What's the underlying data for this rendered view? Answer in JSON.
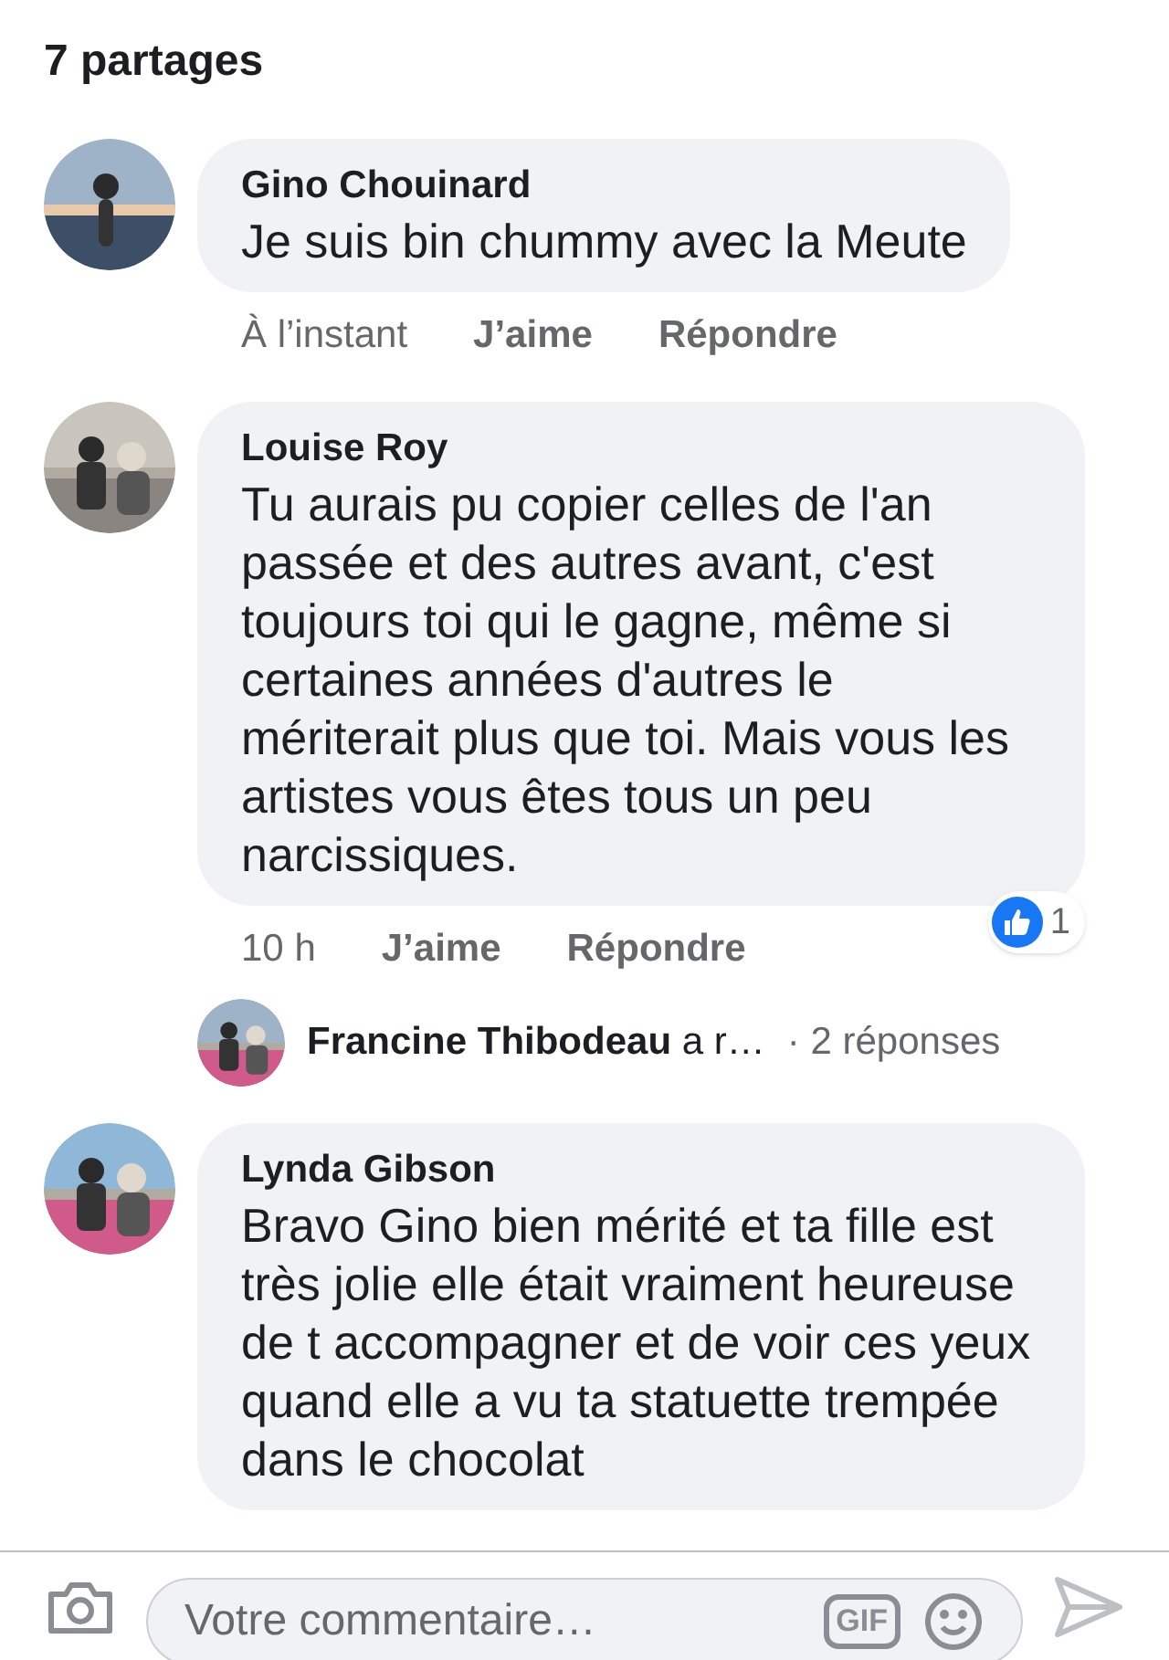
{
  "header": {
    "title": "7 partages"
  },
  "comments": [
    {
      "author": "Gino Chouinard",
      "text": "Je suis bin chummy avec la Meute",
      "time": "À l’instant",
      "like": "J’aime",
      "reply": "Répondre"
    },
    {
      "author": "Louise Roy",
      "text": "Tu aurais pu copier celles de l'an passée et des autres avant, c'est toujours toi qui le gagne, même si certaines années d'autres le mériterait plus que toi. Mais vous les artistes vous êtes tous un peu narcissiques.",
      "time": "10 h",
      "like": "J’aime",
      "reply": "Répondre",
      "reaction_count": "1",
      "replies": {
        "author": "Francine Thibodeau",
        "text": "a r…",
        "count": "· 2 réponses"
      }
    },
    {
      "author": "Lynda Gibson",
      "text": "Bravo Gino bien mérité et ta fille est très jolie elle était vraiment heureuse de t accompagner et de voir ces yeux quand elle a vu ta statuette trempée dans le chocolat"
    }
  ],
  "composer": {
    "placeholder": "Votre commentaire…",
    "gif": "GIF"
  }
}
